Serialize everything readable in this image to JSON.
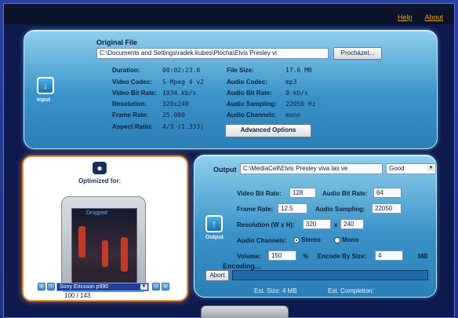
{
  "header": {
    "help": "Help",
    "about": "About"
  },
  "input": {
    "section_label": "Input",
    "original_file_label": "Original File",
    "path": "C:\\Documents and Settings\\radek.kubes\\Plocha\\Elvis Presley  vi",
    "browse_button": "Procházet...",
    "left_labels": [
      "Duration:",
      "Video Codec:",
      "Video Bit Rate:",
      "Resolution:",
      "Frame Rate:",
      "Aspect Ratio:"
    ],
    "left_values": [
      "00:02:23.0",
      "S-Mpeg 4 v2",
      "1034 kb/s",
      "320x240",
      "25.000",
      "4/3 (1.333)"
    ],
    "right_labels": [
      "File Size:",
      "Audio Codec:",
      "Audio Bit Rate:",
      "Audio Sampling:",
      "Audio Channels:"
    ],
    "right_values": [
      "17.6 MB",
      "mp3",
      "0 kb/s",
      "22050 Hz",
      "mono"
    ],
    "advanced_button": "Advanced Options"
  },
  "preview": {
    "title": "Optimized for:",
    "screen_text": "Dropped",
    "device": "Sony Ericsson p990",
    "counter": "100 / 143"
  },
  "output": {
    "section_label": "Output",
    "output_label": "Output",
    "output_path": "C:\\MediaCell\\Elvis Presley  viva las ve",
    "quality": "Good",
    "video_bit_rate_label": "Video Bit Rate:",
    "video_bit_rate": "128",
    "audio_bit_rate_label": "Audio Bit Rate:",
    "audio_bit_rate": "64",
    "frame_rate_label": "Frame Rate:",
    "frame_rate": "12.5",
    "audio_sampling_label": "Audio Sampling:",
    "audio_sampling": "22050",
    "resolution_label": "Resolution (W x H):",
    "res_w": "320",
    "res_x": "x",
    "res_h": "240",
    "channels_label": "Audio Channels:",
    "stereo": "Stereo",
    "mono": "Mono",
    "volume_label": "Volume:",
    "volume": "150",
    "percent": "%",
    "encode_by_size_label": "Encode By Size:",
    "encode_size": "4",
    "mb": "MB",
    "encoding_label": "Encoding...",
    "abort_button": "Abort",
    "est_size": "Est. Size: 4 MB",
    "est_completion": "Est. Completion:"
  }
}
